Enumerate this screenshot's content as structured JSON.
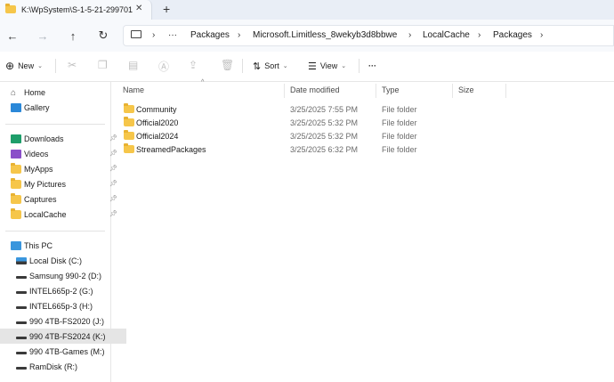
{
  "tab": {
    "title": "K:\\WpSystem\\S-1-5-21-299701"
  },
  "address": {
    "more": "···",
    "crumbs": [
      "Packages",
      "Microsoft.Limitless_8wekyb3d8bbwe",
      "LocalCache",
      "Packages"
    ]
  },
  "commands": {
    "new_label": "New",
    "sort_label": "Sort",
    "view_label": "View",
    "more": "···"
  },
  "sidebar": {
    "quick": [
      {
        "label": "Home",
        "icon": "home-icon"
      },
      {
        "label": "Gallery",
        "icon": "gallery-icon"
      }
    ],
    "pinned": [
      {
        "label": "Downloads",
        "icon": "downloads-icon"
      },
      {
        "label": "Videos",
        "icon": "videos-icon"
      },
      {
        "label": "MyApps",
        "icon": "folder-icon"
      },
      {
        "label": "My Pictures",
        "icon": "folder-icon"
      },
      {
        "label": "Captures",
        "icon": "folder-icon"
      },
      {
        "label": "LocalCache",
        "icon": "folder-icon"
      }
    ],
    "this_pc": "This PC",
    "drives": [
      {
        "label": "Local Disk (C:)",
        "icon": "system-drive-icon"
      },
      {
        "label": "Samsung 990-2 (D:)",
        "icon": "drive-icon"
      },
      {
        "label": "INTEL665p-2 (G:)",
        "icon": "drive-icon"
      },
      {
        "label": "INTEL665p-3 (H:)",
        "icon": "drive-icon"
      },
      {
        "label": "990 4TB-FS2020 (J:)",
        "icon": "drive-icon"
      },
      {
        "label": "990 4TB-FS2024 (K:)",
        "icon": "drive-icon",
        "selected": true
      },
      {
        "label": "990 4TB-Games (M:)",
        "icon": "drive-icon"
      },
      {
        "label": "RamDisk (R:)",
        "icon": "drive-icon"
      }
    ]
  },
  "columns": {
    "name": "Name",
    "date": "Date modified",
    "type": "Type",
    "size": "Size"
  },
  "files": [
    {
      "name": "Community",
      "date": "3/25/2025 7:55 PM",
      "type": "File folder"
    },
    {
      "name": "Official2020",
      "date": "3/25/2025 5:32 PM",
      "type": "File folder"
    },
    {
      "name": "Official2024",
      "date": "3/25/2025 5:32 PM",
      "type": "File folder"
    },
    {
      "name": "StreamedPackages",
      "date": "3/25/2025 6:32 PM",
      "type": "File folder"
    }
  ],
  "colors": {
    "folder": "#f6c64a",
    "selected": "#e5e5e5",
    "accent": "#0067c0"
  }
}
